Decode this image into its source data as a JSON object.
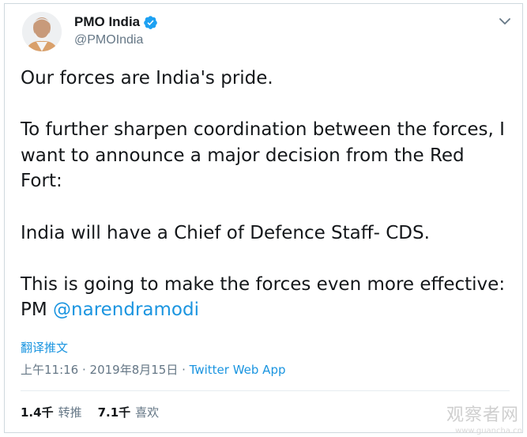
{
  "author": {
    "display_name": "PMO India",
    "handle": "@PMOIndia",
    "verified": true
  },
  "tweet": {
    "paragraphs": [
      "Our forces are India's pride.",
      "To further sharpen coordination between the forces, I want to announce a major decision from the Red Fort:",
      "India will have a Chief of Defence Staff- CDS."
    ],
    "last_paragraph_text": "This is going to make the forces even more effective: PM ",
    "mention": "@narendramodi"
  },
  "translate_label": "翻译推文",
  "meta": {
    "time": "上午11:16",
    "separator": " · ",
    "date": "2019年8月15日",
    "source": "Twitter Web App"
  },
  "stats": {
    "retweets_count": "1.4千",
    "retweets_label": "转推",
    "likes_count": "7.1千",
    "likes_label": "喜欢"
  },
  "watermark": {
    "text": "观察者网",
    "url": "www.guancha.cn"
  },
  "colors": {
    "link": "#1b95e0",
    "secondary": "#657786",
    "primary_text": "#14171a",
    "verified_badge": "#1da1f2"
  }
}
